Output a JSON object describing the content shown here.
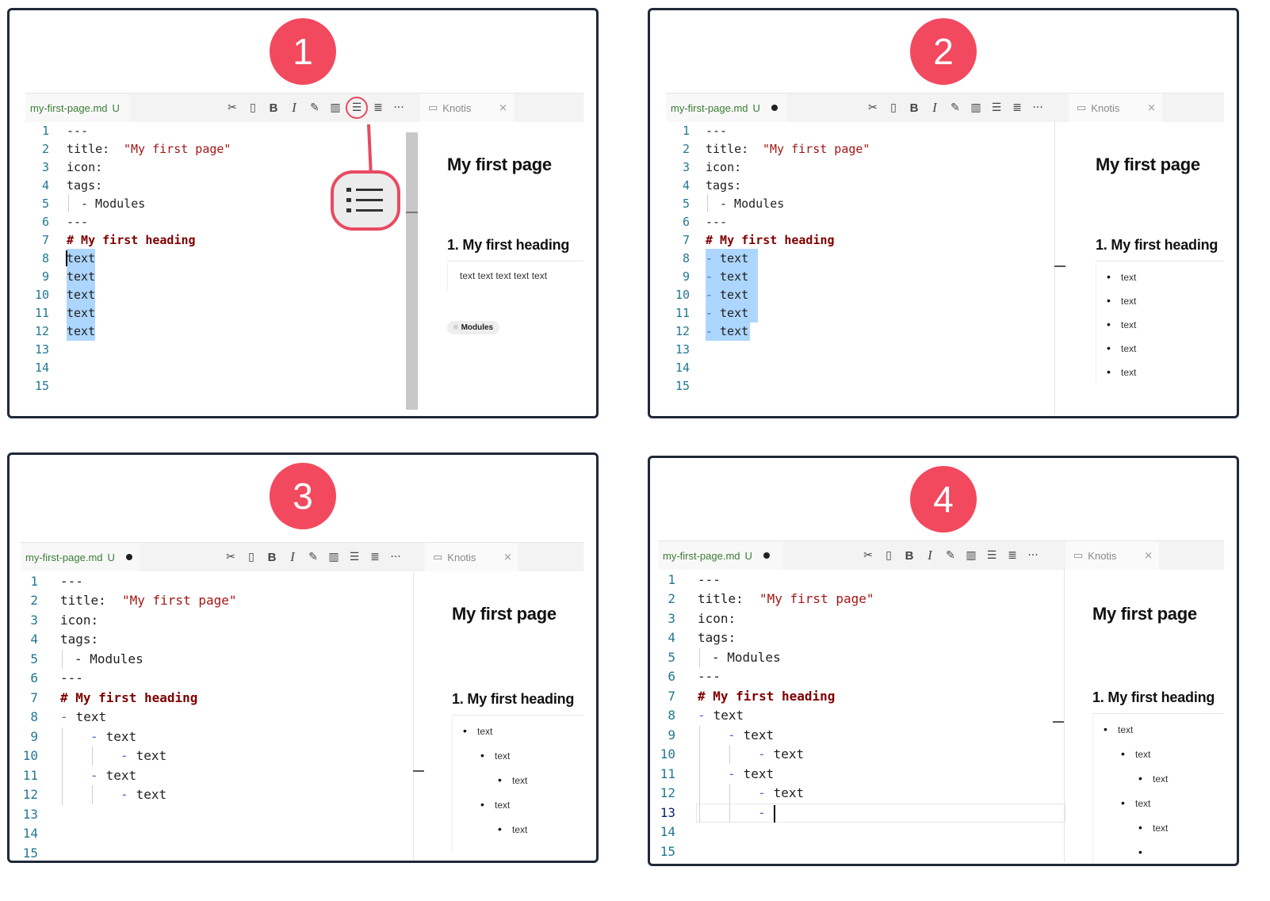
{
  "steps": [
    "1",
    "2",
    "3",
    "4"
  ],
  "file_tab": {
    "name": "my-first-page.md",
    "status": "U"
  },
  "preview_tab": {
    "label": "Knotis",
    "close": "×"
  },
  "toolbar": {
    "bold": "B",
    "italic": "I",
    "more": "···"
  },
  "icons": [
    "cut-icon",
    "document-icon",
    "bold-icon",
    "italic-icon",
    "highlighter-icon",
    "columns-icon",
    "bullet-list-icon",
    "numbered-list-icon",
    "more-icon"
  ],
  "colors": {
    "step_badge": "#f2495f",
    "selection": "#add6ff",
    "heading_text": "#800000",
    "string_text": "#a31515",
    "file_tab_text": "#3a7d34"
  },
  "line_numbers": [
    "1",
    "2",
    "3",
    "4",
    "5",
    "6",
    "7",
    "8",
    "9",
    "10",
    "11",
    "12",
    "13",
    "14",
    "15"
  ],
  "frontmatter": {
    "delim": "---",
    "title_key": "title:",
    "title_value": "\"My first page\"",
    "icon_key": "icon:",
    "tags_key": "tags:",
    "tag_item": "- Modules"
  },
  "heading_line": "# My first heading",
  "item_text": "text",
  "dash": "-",
  "preview": {
    "title": "My first page",
    "heading": "1. My first heading",
    "paragraph": "text text text text text",
    "tag": "Modules",
    "tag_hash": "#",
    "bullet_text": "text"
  }
}
